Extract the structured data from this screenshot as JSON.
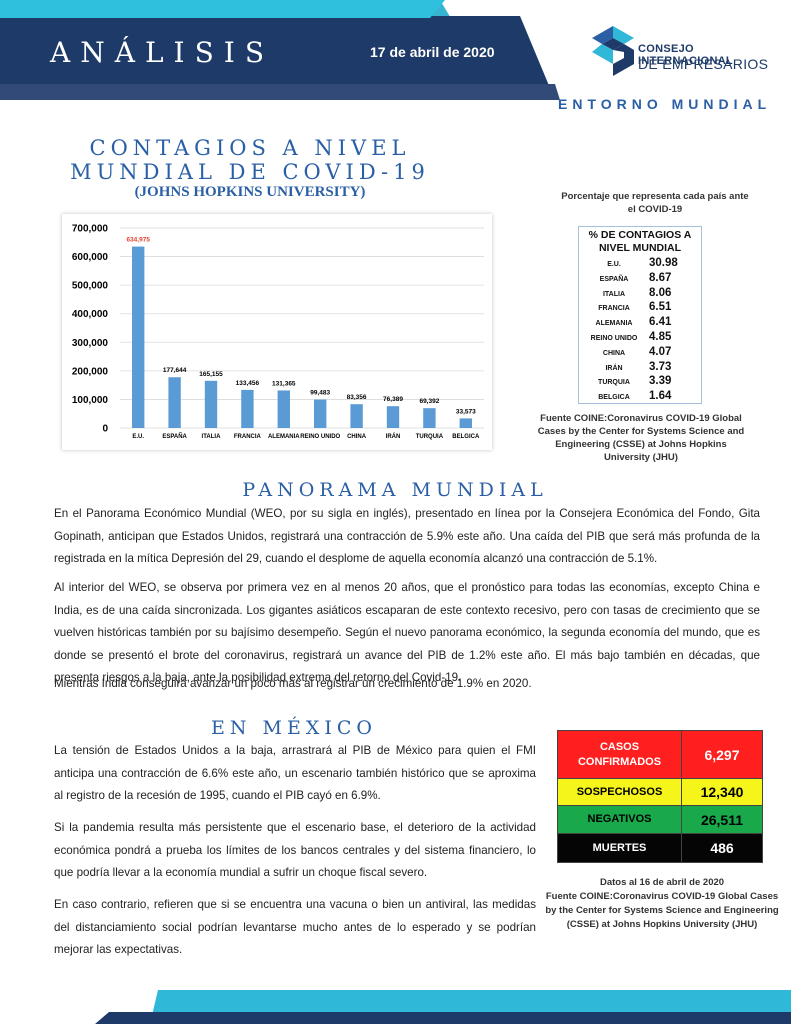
{
  "header": {
    "section": "ANÁLISIS",
    "date": "17 de abril de 2020",
    "logo_line1": "CONSEJO INTERNACIONAL",
    "logo_line2": "DE EMPRESARIOS",
    "subsection": "ENTORNO MUNDIAL"
  },
  "contagios": {
    "title": "CONTAGIOS A NIVEL MUNDIAL DE COVID-19",
    "subtitle": "(JOHNS HOPKINS UNIVERSITY)"
  },
  "chart_data": {
    "type": "bar",
    "categories": [
      "E.U.",
      "ESPAÑA",
      "ITALIA",
      "FRANCIA",
      "ALEMANIA",
      "REINO UNIDO",
      "CHINA",
      "IRÁN",
      "TURQUIA",
      "BELGICA"
    ],
    "values": [
      634975,
      177644,
      165155,
      133456,
      131365,
      99483,
      83356,
      76389,
      69392,
      33573
    ],
    "value_labels": [
      "634,975",
      "177,644",
      "165,155",
      "133,456",
      "131,365",
      "99,483",
      "83,356",
      "76,389",
      "69,392",
      "33,573"
    ],
    "y_ticks": [
      "0",
      "100,000",
      "200,000",
      "300,000",
      "400,000",
      "500,000",
      "600,000",
      "700,000"
    ],
    "ylim": [
      0,
      700000
    ],
    "bar_color": "#5b9bd5",
    "highlight_label_color": "#e0452e",
    "grid": true
  },
  "percent_table": {
    "caption": "Porcentaje que representa cada país ante el COVID-19",
    "header": "% DE CONTAGIOS A NIVEL MUNDIAL",
    "rows": [
      {
        "country": "E.U.",
        "value": "30.98"
      },
      {
        "country": "ESPAÑA",
        "value": "8.67"
      },
      {
        "country": "ITALIA",
        "value": "8.06"
      },
      {
        "country": "FRANCIA",
        "value": "6.51"
      },
      {
        "country": "ALEMANIA",
        "value": "6.41"
      },
      {
        "country": "REINO UNIDO",
        "value": "4.85"
      },
      {
        "country": "CHINA",
        "value": "4.07"
      },
      {
        "country": "IRÁN",
        "value": "3.73"
      },
      {
        "country": "TURQUIA",
        "value": "3.39"
      },
      {
        "country": "BELGICA",
        "value": "1.64"
      }
    ],
    "source": "Fuente COINE:Coronavirus COVID-19 Global Cases by the Center for Systems Science and Engineering (CSSE) at Johns Hopkins University (JHU)"
  },
  "panorama": {
    "title": "PANORAMA MUNDIAL",
    "paragraphs": [
      "En el Panorama Económico Mundial (WEO, por su sigla en inglés), presentado en línea por la Consejera Económica del Fondo, Gita Gopinath, anticipan que Estados Unidos, registrará una contracción de 5.9% este año. Una caída del PIB que será más profunda de la registrada en la mítica Depresión del 29, cuando el desplome de aquella economía alcanzó una contracción de 5.1%.",
      "Al interior del WEO, se observa por primera vez en al menos 20 años, que el pronóstico para todas las economías, excepto China e India, es de una caída sincronizada. Los gigantes asiáticos escaparan de este contexto recesivo, pero con tasas de crecimiento que se vuelven históricas también por su bajísimo desempeño. Según el nuevo panorama económico, la segunda economía del mundo, que es donde se presentó el brote del coronavirus, registrará un avance del PIB de 1.2% este año. El más bajo también en décadas, que presenta riesgos a la baja, ante la posibilidad extrema del retorno del Covid-19.",
      "Mientras India conseguirá avanzar un poco más al registrar un crecimiento de 1.9% en 2020."
    ]
  },
  "mexico": {
    "title": "EN MÉXICO",
    "paragraphs": [
      "La tensión de Estados Unidos a la baja, arrastrará al PIB de México para quien el FMI anticipa una contracción de 6.6% este año, un escenario también histórico que se aproxima al registro de la recesión de 1995, cuando el PIB cayó en 6.9%.",
      "Si la pandemia resulta más persistente que el escenario base, el deterioro de la actividad económica pondrá a prueba los límites de los bancos centrales y del sistema financiero, lo que podría llevar a la economía mundial a sufrir un choque fiscal severo.",
      "En caso contrario, refieren que si se encuentra una vacuna o bien un antiviral, las medidas del distanciamiento social podrían levantarse mucho antes de lo esperado y se podrían mejorar las expectativas."
    ],
    "stats": [
      {
        "label": "CASOS CONFIRMADOS",
        "value": "6,297",
        "bg": "#ff1f1f",
        "fg": "#ffffff"
      },
      {
        "label": "SOSPECHOSOS",
        "value": "12,340",
        "bg": "#f5f51c",
        "fg": "#000000"
      },
      {
        "label": "NEGATIVOS",
        "value": "26,511",
        "bg": "#19a84a",
        "fg": "#000000"
      },
      {
        "label": "MUERTES",
        "value": "486",
        "bg": "#050505",
        "fg": "#ffffff"
      }
    ],
    "stats_caption": "Datos al 16 de abril de 2020",
    "stats_source": "Fuente COINE:Coronavirus COVID-19 Global Cases by the Center for Systems Science and Engineering (CSSE) at Johns Hopkins University (JHU)"
  }
}
